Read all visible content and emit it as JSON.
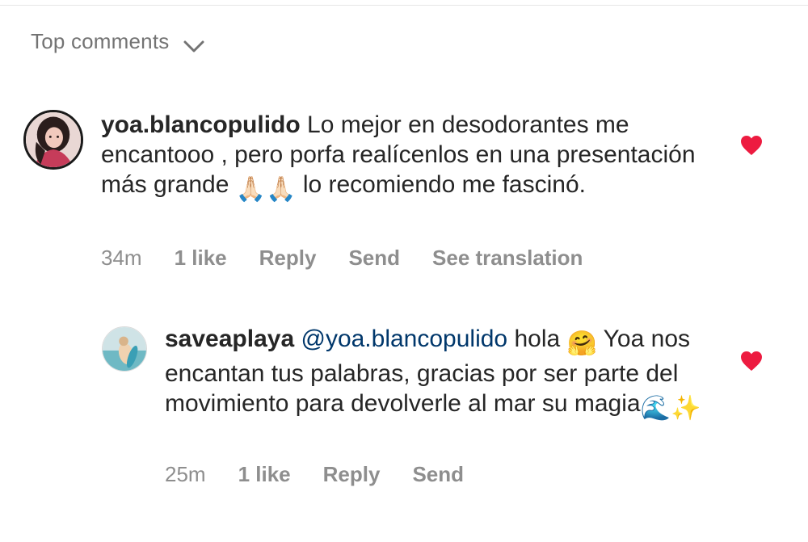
{
  "header": {
    "sort_label": "Top comments",
    "dropdown_icon": "chevron-down-icon"
  },
  "comments": [
    {
      "username": "yoa.blancopulido",
      "text_part1": " Lo mejor en desodorantes me encantooo , pero porfa realícenlos en una presentación más grande ",
      "emoji1": "🙏🏻🙏🏻",
      "text_part2": " lo recomiendo me fascinó.",
      "time": "34m",
      "likes": "1 like",
      "reply_label": "Reply",
      "send_label": "Send",
      "translation_label": "See translation",
      "liked": true,
      "like_color": "#ed4956"
    },
    {
      "username": "saveaplaya",
      "mention": "@yoa.blancopulido",
      "text_part1": " hola ",
      "emoji1": "🤗",
      "text_part2": " Yoa nos encantan tus palabras, gracias por ser parte del movimiento para devolverle al mar su magia",
      "emoji2": "🌊✨",
      "time": "25m",
      "likes": "1 like",
      "reply_label": "Reply",
      "send_label": "Send",
      "liked": true,
      "like_color": "#ed4956"
    }
  ]
}
